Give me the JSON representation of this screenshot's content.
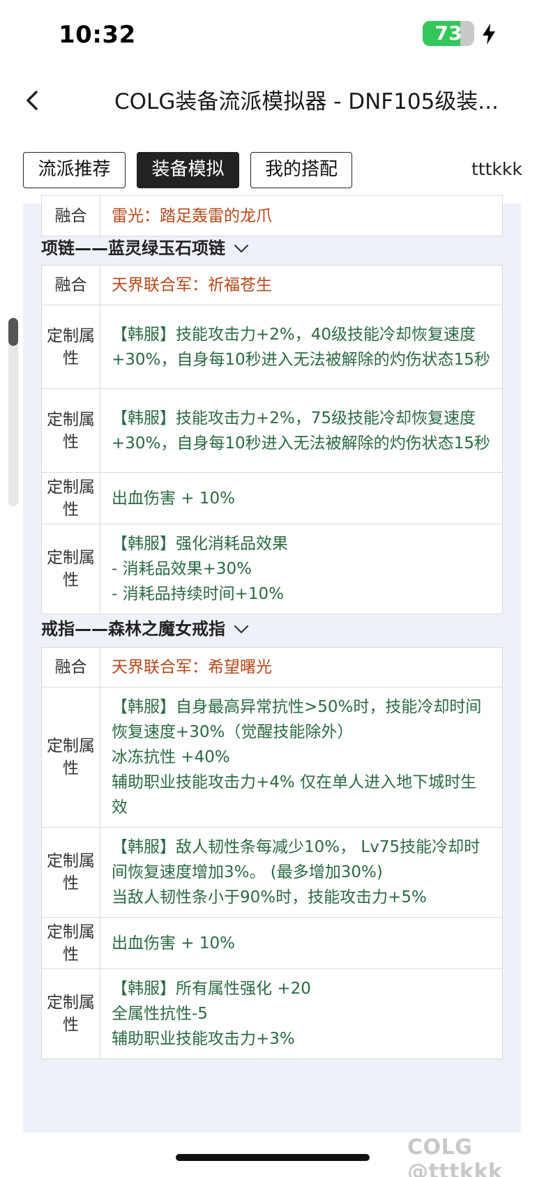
{
  "status": {
    "time": "10:32",
    "battery": "73",
    "battery_level": 0.73
  },
  "nav": {
    "title": "COLG装备流派模拟器 - DNF105级装..."
  },
  "tabs": [
    {
      "label": "流派推荐"
    },
    {
      "label": "装备模拟"
    },
    {
      "label": "我的搭配"
    }
  ],
  "user": "tttkkk",
  "top_row": {
    "label": "融合",
    "value": "雷光：踏足轰雷的龙爪"
  },
  "necklace": {
    "title": "项链——蓝灵绿玉石项链",
    "rows": [
      {
        "label": "融合",
        "value": "天界联合军：祈福苍生"
      },
      {
        "label": "定制属性",
        "value": "【韩服】技能攻击力+2%，40级技能冷却恢复速度+30%，自身每10秒进入无法被解除的灼伤状态15秒"
      },
      {
        "label": "定制属性",
        "value": "【韩服】技能攻击力+2%，75级技能冷却恢复速度+30%，自身每10秒进入无法被解除的灼伤状态15秒"
      },
      {
        "label": "定制属性",
        "value": "出血伤害 + 10%"
      },
      {
        "label": "定制属性",
        "lines": [
          "【韩服】强化消耗品效果",
          "- 消耗品效果+30%",
          "- 消耗品持续时间+10%"
        ]
      }
    ]
  },
  "ring": {
    "title": "戒指——森林之魔女戒指",
    "rows": [
      {
        "label": "融合",
        "value": "天界联合军：希望曙光"
      },
      {
        "label": "定制属性",
        "lines": [
          "【韩服】自身最高异常抗性>50%时，技能冷却时间恢复速度+30%（觉醒技能除外）",
          "冰冻抗性 +40%",
          "辅助职业技能攻击力+4% 仅在单人进入地下城时生效"
        ]
      },
      {
        "label": "定制属性",
        "lines": [
          "【韩服】敌人韧性条每减少10%， Lv75技能冷却时间恢复速度增加3%。 (最多增加30%)",
          "当敌人韧性条小于90%时，技能攻击力+5%"
        ]
      },
      {
        "label": "定制属性",
        "value": "出血伤害 + 10%"
      },
      {
        "label": "定制属性",
        "lines": [
          "【韩服】所有属性强化 +20",
          "全属性抗性-5",
          "辅助职业技能攻击力+3%"
        ]
      }
    ]
  },
  "watermark": "COLG @tttkkk",
  "colors": {
    "fuse_text": "#b4481a",
    "custom_text": "#2a6a41",
    "panel_bg": "#eef1f8",
    "battery_green": "#34c759"
  }
}
